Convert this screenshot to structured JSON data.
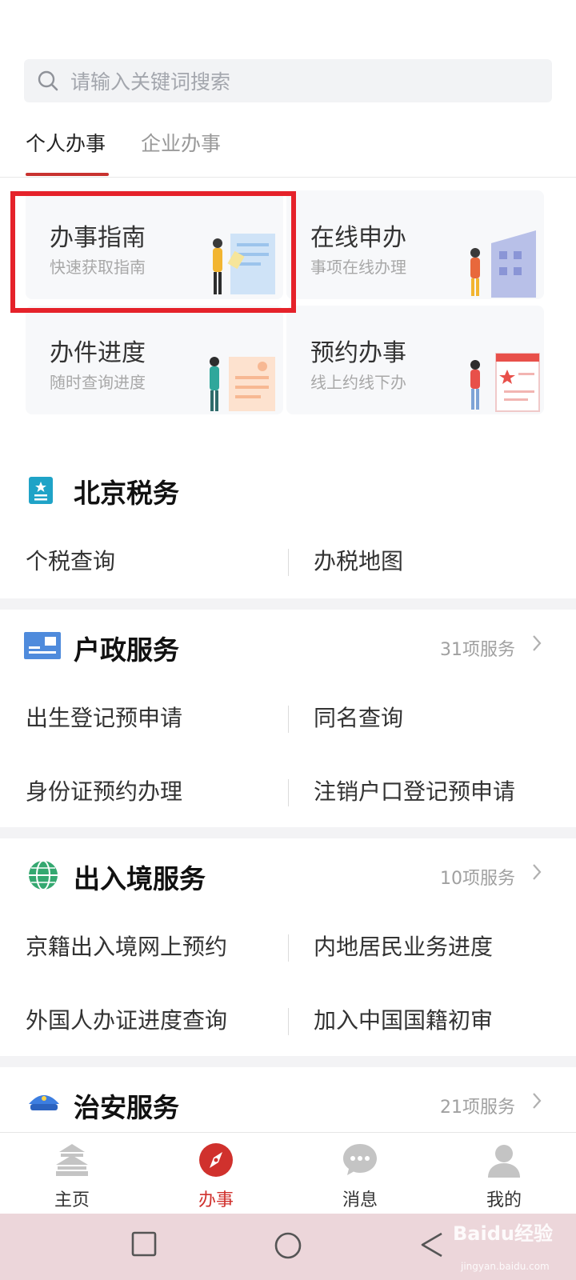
{
  "search": {
    "placeholder": "请输入关键词搜索"
  },
  "tabs": [
    {
      "label": "个人办事",
      "active": true
    },
    {
      "label": "企业办事",
      "active": false
    }
  ],
  "cards": [
    {
      "title": "办事指南",
      "subtitle": "快速获取指南",
      "highlighted": true
    },
    {
      "title": "在线申办",
      "subtitle": "事项在线办理"
    },
    {
      "title": "办件进度",
      "subtitle": "随时查询进度"
    },
    {
      "title": "预约办事",
      "subtitle": "线上约线下办"
    }
  ],
  "sections": [
    {
      "title": "北京税务",
      "icon": "tax-icon",
      "rows": [
        [
          "个税查询",
          "办税地图"
        ]
      ]
    },
    {
      "title": "户政服务",
      "icon": "household-icon",
      "count": "31项服务",
      "rows": [
        [
          "出生登记预申请",
          "同名查询"
        ],
        [
          "身份证预约办理",
          "注销户口登记预申请"
        ]
      ]
    },
    {
      "title": "出入境服务",
      "icon": "globe-icon",
      "count": "10项服务",
      "rows": [
        [
          "京籍出入境网上预约",
          "内地居民业务进度"
        ],
        [
          "外国人办证进度查询",
          "加入中国国籍初审"
        ]
      ]
    },
    {
      "title": "治安服务",
      "icon": "police-cap-icon",
      "count": "21项服务"
    }
  ],
  "tabbar": [
    {
      "label": "主页",
      "icon": "temple-icon",
      "active": false
    },
    {
      "label": "办事",
      "icon": "compass-icon",
      "active": true
    },
    {
      "label": "消息",
      "icon": "chat-icon",
      "active": false
    },
    {
      "label": "我的",
      "icon": "person-icon",
      "active": false
    }
  ],
  "watermark": {
    "brand": "Baidu经验",
    "url": "jingyan.baidu.com"
  },
  "colors": {
    "accent": "#d0312d",
    "highlight": "#e5222a",
    "tab_underline": "#c8322f"
  }
}
